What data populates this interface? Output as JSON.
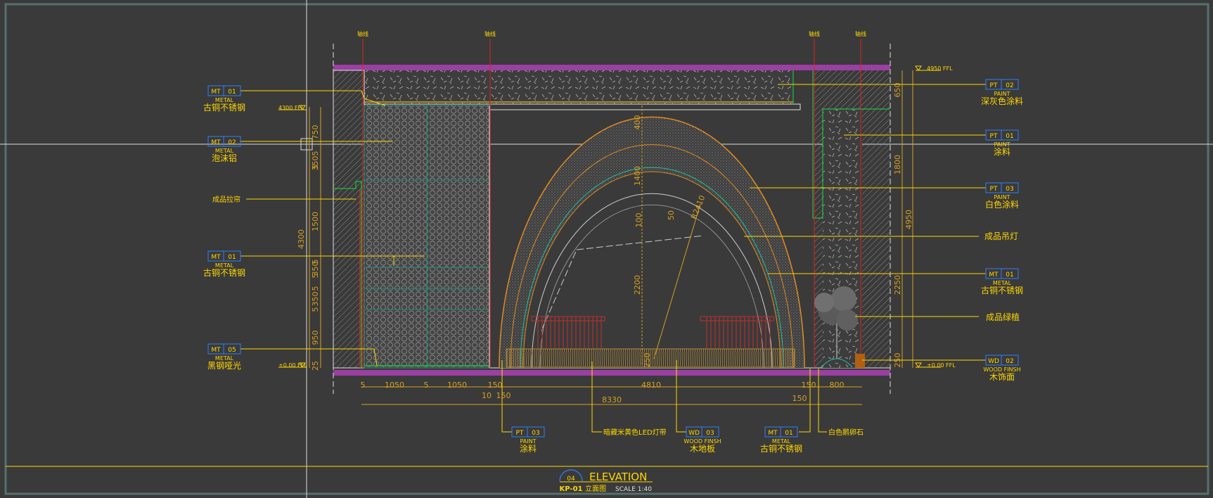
{
  "tags_left": [
    {
      "code": "MT",
      "num": "01",
      "type": "METAL",
      "name": "古铜不锈钢"
    },
    {
      "code": "MT",
      "num": "02",
      "type": "METAL",
      "name": "泡沫铝"
    },
    {
      "code": "MT",
      "num": "01",
      "type": "METAL",
      "name": "古铜不锈钢"
    },
    {
      "code": "MT",
      "num": "05",
      "type": "METAL",
      "name": "黑钢哑光"
    }
  ],
  "label_left_plain": "成品拉帘",
  "tags_right": [
    {
      "code": "PT",
      "num": "02",
      "type": "PAINT",
      "name": "深灰色涂料"
    },
    {
      "code": "PT",
      "num": "01",
      "type": "PAINT",
      "name": "涂料"
    },
    {
      "code": "PT",
      "num": "03",
      "type": "PAINT",
      "name": "白色涂料"
    },
    {
      "code": "MT",
      "num": "01",
      "type": "METAL",
      "name": "古铜不锈钢"
    },
    {
      "code": "WD",
      "num": "02",
      "type": "WOOD FINSH",
      "name": "木饰面"
    }
  ],
  "labels_right_plain": [
    "成品吊灯",
    "成品绿植"
  ],
  "tags_bottom": [
    {
      "code": "PT",
      "num": "03",
      "type": "PAINT",
      "name": "涂料"
    },
    {
      "code": "WD",
      "num": "03",
      "type": "WOOD FINSH",
      "name": "木地板"
    },
    {
      "code": "MT",
      "num": "01",
      "type": "METAL",
      "name": "古铜不锈钢"
    }
  ],
  "labels_bottom_plain": [
    "暗藏米黄色LED灯带",
    "白色鹅卵石"
  ],
  "level_marks": {
    "left_top": "4300 FFL",
    "left_bottom": "±0.00 FFL",
    "right_top": "4950 FFL",
    "right_bottom": "±0.00 FFL"
  },
  "axis_marks": [
    "轴线",
    "轴线",
    "轴线",
    "轴线"
  ],
  "dims_left_segments": [
    "750",
    "5",
    "350",
    "5",
    "1500",
    "5",
    "350",
    "5",
    "5",
    "350",
    "5",
    "950",
    "25"
  ],
  "dims_left_total": "4300",
  "dims_right_segments": [
    "650",
    "1800",
    "2250",
    "250"
  ],
  "dims_right_total": "4950",
  "dims_bottom_row1": [
    "5",
    "1050",
    "5",
    "1050",
    "150",
    "4810",
    "150",
    "800"
  ],
  "dims_bottom_row2": [
    "10",
    "150",
    "150"
  ],
  "dims_bottom_total": "8330",
  "dims_arch": [
    "400",
    "1400",
    "2200",
    "250",
    "R2410",
    "100",
    "50"
  ],
  "title_block": {
    "num": "04",
    "sheet": "KP-01",
    "title": "ELEVATION",
    "subtitle": "立面图",
    "scale": "SCALE  1:40"
  }
}
